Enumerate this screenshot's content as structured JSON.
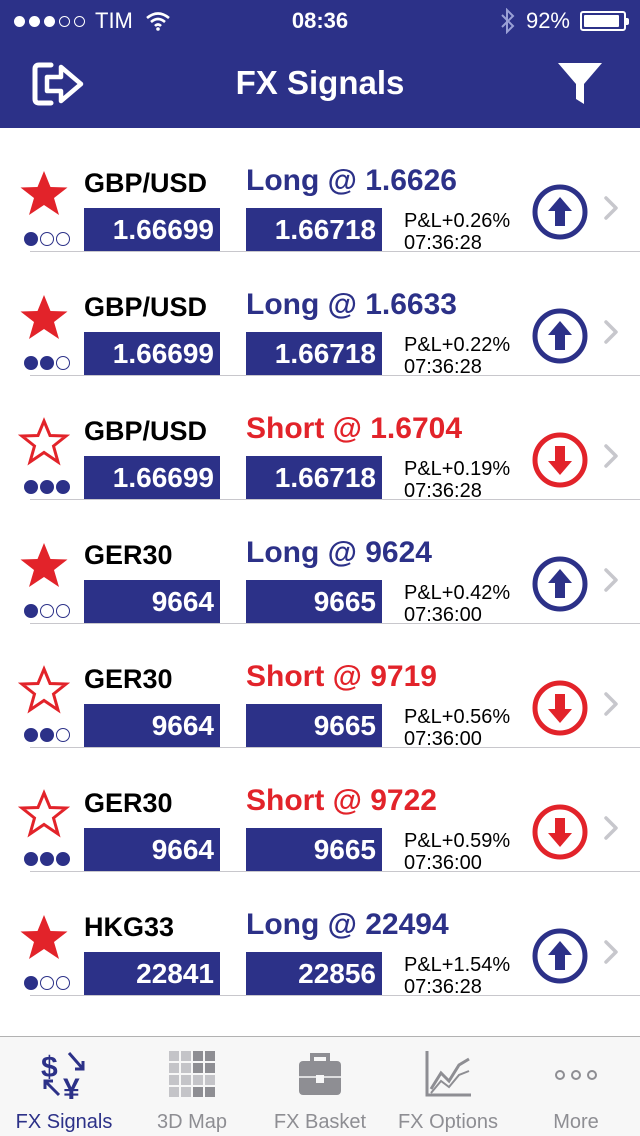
{
  "status_bar": {
    "carrier": "TIM",
    "time": "08:36",
    "battery": "92%",
    "battery_level": 0.92
  },
  "nav": {
    "title": "FX Signals",
    "left_icon": "logout-icon",
    "right_icon": "filter-icon"
  },
  "colors": {
    "brand": "#2c3188",
    "long": "#2c3188",
    "short": "#e2232a",
    "star": "#e2232a"
  },
  "signals": [
    {
      "symbol": "GBP/USD",
      "signal": "Long @ 1.6626",
      "direction": "long",
      "bid": "1.66699",
      "ask": "1.66718",
      "pl": "P&L+0.26%",
      "time": "07:36:28",
      "favorite": true,
      "strength": 1
    },
    {
      "symbol": "GBP/USD",
      "signal": "Long @ 1.6633",
      "direction": "long",
      "bid": "1.66699",
      "ask": "1.66718",
      "pl": "P&L+0.22%",
      "time": "07:36:28",
      "favorite": true,
      "strength": 2
    },
    {
      "symbol": "GBP/USD",
      "signal": "Short @ 1.6704",
      "direction": "short",
      "bid": "1.66699",
      "ask": "1.66718",
      "pl": "P&L+0.19%",
      "time": "07:36:28",
      "favorite": false,
      "strength": 3
    },
    {
      "symbol": "GER30",
      "signal": "Long @ 9624",
      "direction": "long",
      "bid": "9664",
      "ask": "9665",
      "pl": "P&L+0.42%",
      "time": "07:36:00",
      "favorite": true,
      "strength": 1
    },
    {
      "symbol": "GER30",
      "signal": "Short @ 9719",
      "direction": "short",
      "bid": "9664",
      "ask": "9665",
      "pl": "P&L+0.56%",
      "time": "07:36:00",
      "favorite": false,
      "strength": 2
    },
    {
      "symbol": "GER30",
      "signal": "Short @ 9722",
      "direction": "short",
      "bid": "9664",
      "ask": "9665",
      "pl": "P&L+0.59%",
      "time": "07:36:00",
      "favorite": false,
      "strength": 3
    },
    {
      "symbol": "HKG33",
      "signal": "Long @ 22494",
      "direction": "long",
      "bid": "22841",
      "ask": "22856",
      "pl": "P&L+1.54%",
      "time": "07:36:28",
      "favorite": true,
      "strength": 1
    }
  ],
  "tabs": [
    {
      "label": "FX Signals",
      "icon": "fx-signals-icon",
      "active": true
    },
    {
      "label": "3D Map",
      "icon": "map-grid-icon",
      "active": false
    },
    {
      "label": "FX Basket",
      "icon": "briefcase-icon",
      "active": false
    },
    {
      "label": "FX Options",
      "icon": "line-chart-icon",
      "active": false
    },
    {
      "label": "More",
      "icon": "more-dots-icon",
      "active": false
    }
  ]
}
